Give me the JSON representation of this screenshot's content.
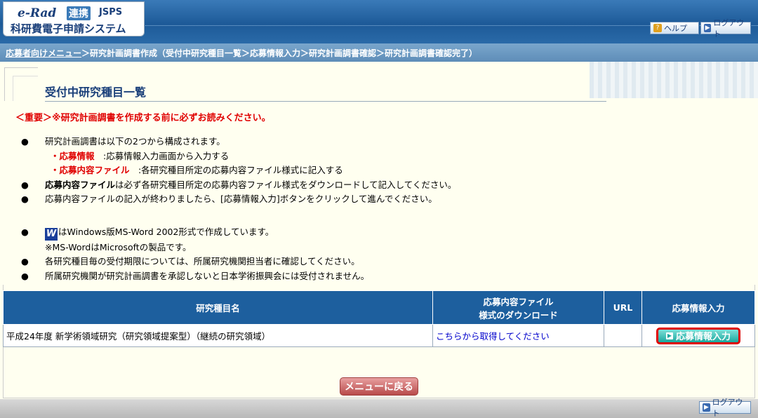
{
  "header": {
    "logo_erad": "e-Rad",
    "logo_renkei": "連携",
    "logo_jsps": "JSPS",
    "logo_system": "科研費電子申請システム",
    "help_label": "ヘルプ",
    "logout_label": "ログアウト"
  },
  "breadcrumb": {
    "link": "応募者向けメニュー",
    "rest": "＞研究計画調書作成（受付中研究種目一覧＞応募情報入力＞研究計画調書確認＞研究計画調書確認完了）"
  },
  "page": {
    "title": "受付中研究種目一覧",
    "important": "＜重要＞※研究計画調書を作成する前に必ずお読みください。"
  },
  "notes": {
    "n1": "研究計画調書は以下の2つから構成されます。",
    "n1a_prefix": "・",
    "n1a_red": "応募情報",
    "n1a_text": "　:応募情報入力画面から入力する",
    "n1b_prefix": "・",
    "n1b_red": "応募内容ファイル",
    "n1b_text": "　:各研究種目所定の応募内容ファイル様式に記入する",
    "n2_bold": "応募内容ファイル",
    "n2_text": "は必ず各研究種目所定の応募内容ファイル様式をダウンロードして記入してください。",
    "n3": "応募内容ファイルの記入が終わりましたら、[応募情報入力]ボタンをクリックして進んでください。",
    "n4_icon": "W",
    "n4": "はWindows版MS-Word 2002形式で作成しています。",
    "n4b": "※MS-WordはMicrosoftの製品です。",
    "n5": "各研究種目毎の受付期限については、所属研究機関担当者に確認してください。",
    "n6": "所属研究機関が研究計画調書を承認しないと日本学術振興会には受付されません。"
  },
  "table": {
    "headers": {
      "name": "研究種目名",
      "download_line1": "応募内容ファイル",
      "download_line2": "様式のダウンロード",
      "url": "URL",
      "input": "応募情報入力"
    },
    "rows": [
      {
        "name": "平成24年度 新学術領域研究（研究領域提案型）（継続の研究領域）",
        "download": "こちらから取得してください",
        "url": "",
        "button": "応募情報入力"
      }
    ]
  },
  "footer": {
    "menu_button": "メニューに戻る",
    "logout_label": "ログアウト"
  }
}
